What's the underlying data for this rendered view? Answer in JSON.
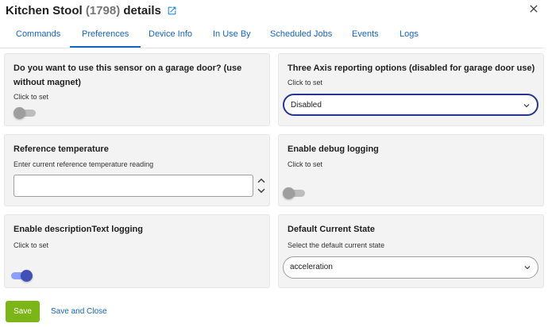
{
  "header": {
    "device_name": "Kitchen Stool",
    "device_id": "(1798)",
    "suffix": "details",
    "external_link_icon": "open-in-new-icon",
    "close_icon": "close-icon"
  },
  "tabs": [
    {
      "label": "Commands",
      "active": false
    },
    {
      "label": "Preferences",
      "active": true
    },
    {
      "label": "Device Info",
      "active": false
    },
    {
      "label": "In Use By",
      "active": false
    },
    {
      "label": "Scheduled Jobs",
      "active": false
    },
    {
      "label": "Events",
      "active": false
    },
    {
      "label": "Logs",
      "active": false
    }
  ],
  "prefs": {
    "garage": {
      "title": "Do you want to use this sensor on a garage door? (use without magnet)",
      "hint": "Click to set",
      "enabled": false
    },
    "three_axis": {
      "title": "Three Axis reporting options (disabled for garage door use)",
      "hint": "Click to set",
      "value": "Disabled"
    },
    "reference_temp": {
      "title": "Reference temperature",
      "hint": "Enter current reference temperature reading",
      "value": ""
    },
    "debug": {
      "title": "Enable debug logging",
      "hint": "Click to set",
      "enabled": false
    },
    "desc_text": {
      "title": "Enable descriptionText logging",
      "hint": "Click to set",
      "enabled": true
    },
    "default_state": {
      "title": "Default Current State",
      "hint": "Select the default current state",
      "value": "acceleration"
    }
  },
  "footer": {
    "save_label": "Save",
    "save_close_label": "Save and Close"
  },
  "colors": {
    "accent": "#1565c0",
    "save_button": "#7cb518",
    "toggle_on": "#3f51b5",
    "toggle_off": "#9e9e9e",
    "card_bg": "#f3f3f3"
  }
}
